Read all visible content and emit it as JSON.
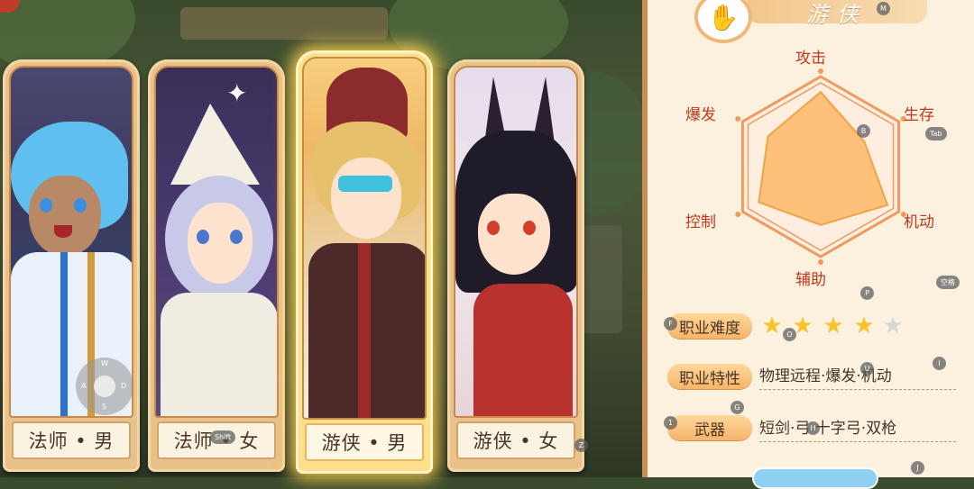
{
  "class_panel": {
    "title": "游侠",
    "emblem_icon": "hand-icon",
    "radar_stats": [
      {
        "label": "攻击",
        "value": 0.92
      },
      {
        "label": "生存",
        "value": 0.62
      },
      {
        "label": "机动",
        "value": 0.95
      },
      {
        "label": "辅助",
        "value": 0.72
      },
      {
        "label": "控制",
        "value": 0.88
      },
      {
        "label": "爆发",
        "value": 0.75
      }
    ],
    "difficulty_label": "职业难度",
    "difficulty_stars": 4,
    "difficulty_max": 5,
    "traits_label": "职业特性",
    "traits_value": "物理远程·爆发·机动",
    "weapon_label": "武器",
    "weapon_value": "短剑·弓·十字弓·双枪"
  },
  "characters": [
    {
      "label": "法师 • 男",
      "selected": false
    },
    {
      "label": "法师 • 女",
      "selected": false
    },
    {
      "label": "游侠 • 男",
      "selected": true
    },
    {
      "label": "游侠 • 女",
      "selected": false
    }
  ],
  "key_hints": {
    "m": "M",
    "b": "B",
    "tab": "Tab",
    "p": "P",
    "space": "空格",
    "f": "F",
    "o": "O",
    "u": "U",
    "i": "I",
    "g": "G",
    "one": "1",
    "h": "H",
    "shift": "Shift",
    "z": "Z",
    "j": "J",
    "joystick": {
      "w": "W",
      "a": "A",
      "s": "S",
      "d": "D"
    }
  },
  "colors": {
    "accent": "#f5b56b",
    "stat_text": "#c0391f",
    "panel_bg": "#fbf1de",
    "selected_glow": "#ffd24f"
  }
}
